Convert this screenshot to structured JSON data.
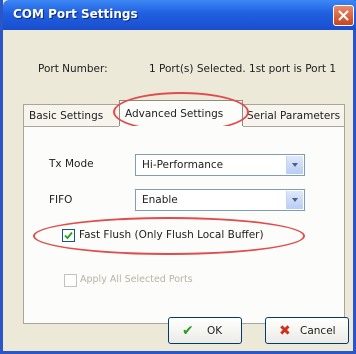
{
  "window": {
    "title": "COM Port Settings",
    "close_icon": "close-icon"
  },
  "port": {
    "label": "Port Number:",
    "value": "1 Port(s) Selected. 1st port is Port 1"
  },
  "tabs": [
    {
      "label": "Basic Settings"
    },
    {
      "label": "Advanced Settings",
      "active": true
    },
    {
      "label": "Serial Parameters"
    }
  ],
  "fields": {
    "tx_mode": {
      "label": "Tx Mode",
      "value": "Hi-Performance"
    },
    "fifo": {
      "label": "FIFO",
      "value": "Enable"
    }
  },
  "fast_flush": {
    "label": "Fast Flush (Only Flush Local Buffer)",
    "checked": true
  },
  "apply_all": {
    "label": "Apply All Selected Ports",
    "checked": false,
    "disabled": true
  },
  "buttons": {
    "ok": {
      "label": "OK",
      "icon": "check-icon"
    },
    "cancel": {
      "label": "Cancel",
      "icon": "cross-icon"
    }
  },
  "colors": {
    "title_bar": "#1f5fe0",
    "highlight": "#e04c4c",
    "ok_icon": "#2a9c2a",
    "cancel_icon": "#d03020"
  }
}
